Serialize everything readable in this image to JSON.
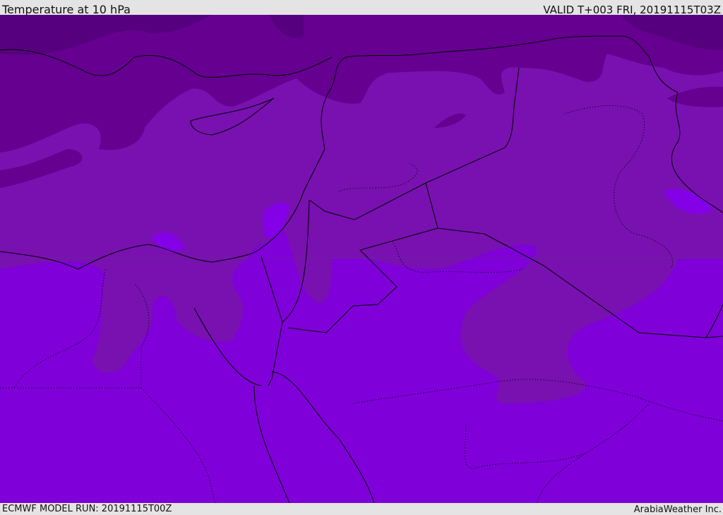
{
  "header": {
    "title": "Temperature at 10 hPa",
    "valid": "VALID T+003 FRI, 20191115T03Z"
  },
  "footer": {
    "model_run": "ECMWF MODEL RUN: 20191115T00Z",
    "credit": "ArabiaWeather Inc."
  },
  "colors": {
    "darkest": "#57007f",
    "dark": "#650090",
    "medium": "#7811b0",
    "bright": "#7f00d8",
    "light_patch": "#8400e6",
    "border": "#000000"
  }
}
